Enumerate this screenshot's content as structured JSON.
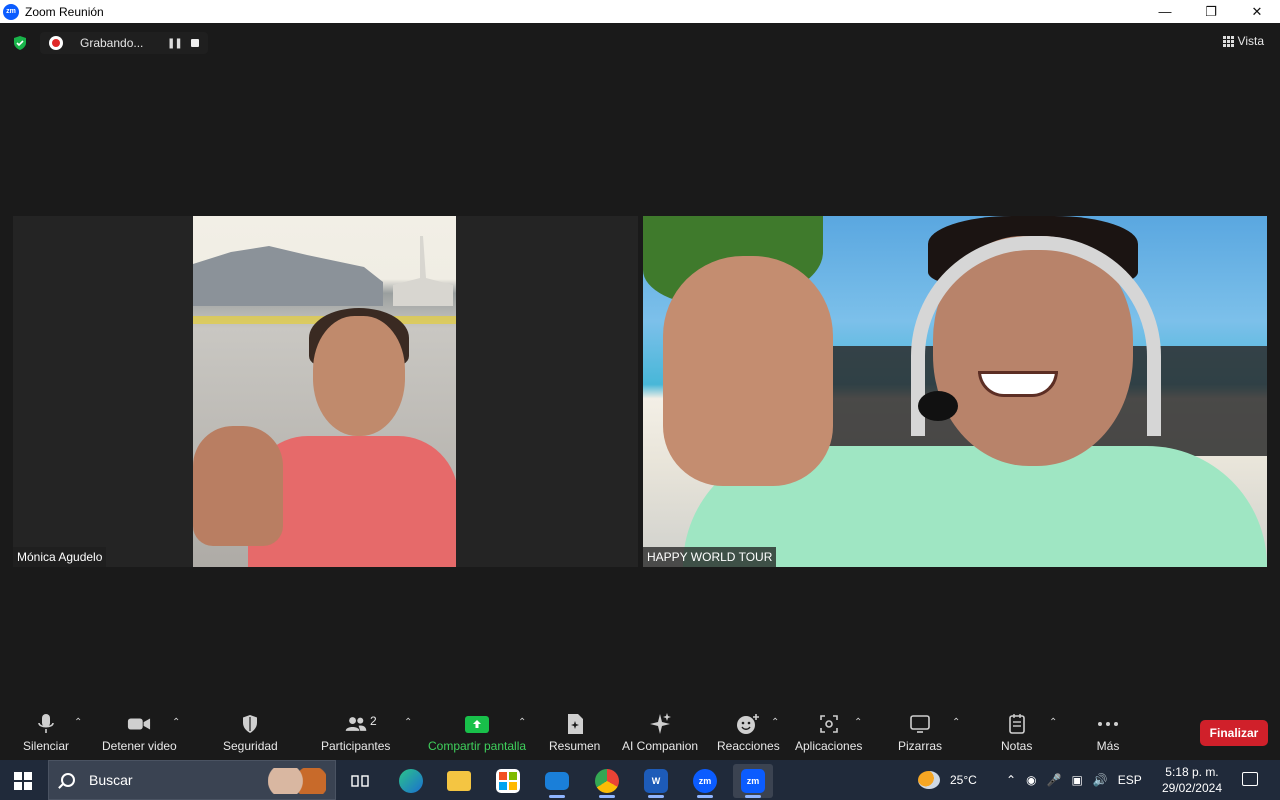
{
  "window": {
    "title": "Zoom Reunión",
    "app_icon": "zm"
  },
  "recording": {
    "label": "Grabando..."
  },
  "view": {
    "label": "Vista"
  },
  "participants": [
    {
      "name": "Mónica Agudelo"
    },
    {
      "name": "HAPPY WORLD TOUR"
    }
  ],
  "toolbar": {
    "mute": "Silenciar",
    "video": "Detener video",
    "security": "Seguridad",
    "participants": "Participantes",
    "participants_count": "2",
    "share": "Compartir pantalla",
    "summary": "Resumen",
    "ai": "AI Companion",
    "reactions": "Reacciones",
    "apps": "Aplicaciones",
    "whiteboards": "Pizarras",
    "notes": "Notas",
    "more": "Más",
    "end": "Finalizar"
  },
  "taskbar": {
    "search_placeholder": "Buscar",
    "weather": "25°C",
    "lang": "ESP",
    "time": "5:18 p. m.",
    "date": "29/02/2024",
    "apps": [
      "task-view",
      "edge",
      "file-explorer",
      "microsoft-store",
      "mail",
      "chrome",
      "word",
      "zoom",
      "zoom-meeting"
    ]
  },
  "colors": {
    "accent_green": "#18c04a",
    "end_red": "#d0202a",
    "zoom_blue": "#0b5cff"
  }
}
